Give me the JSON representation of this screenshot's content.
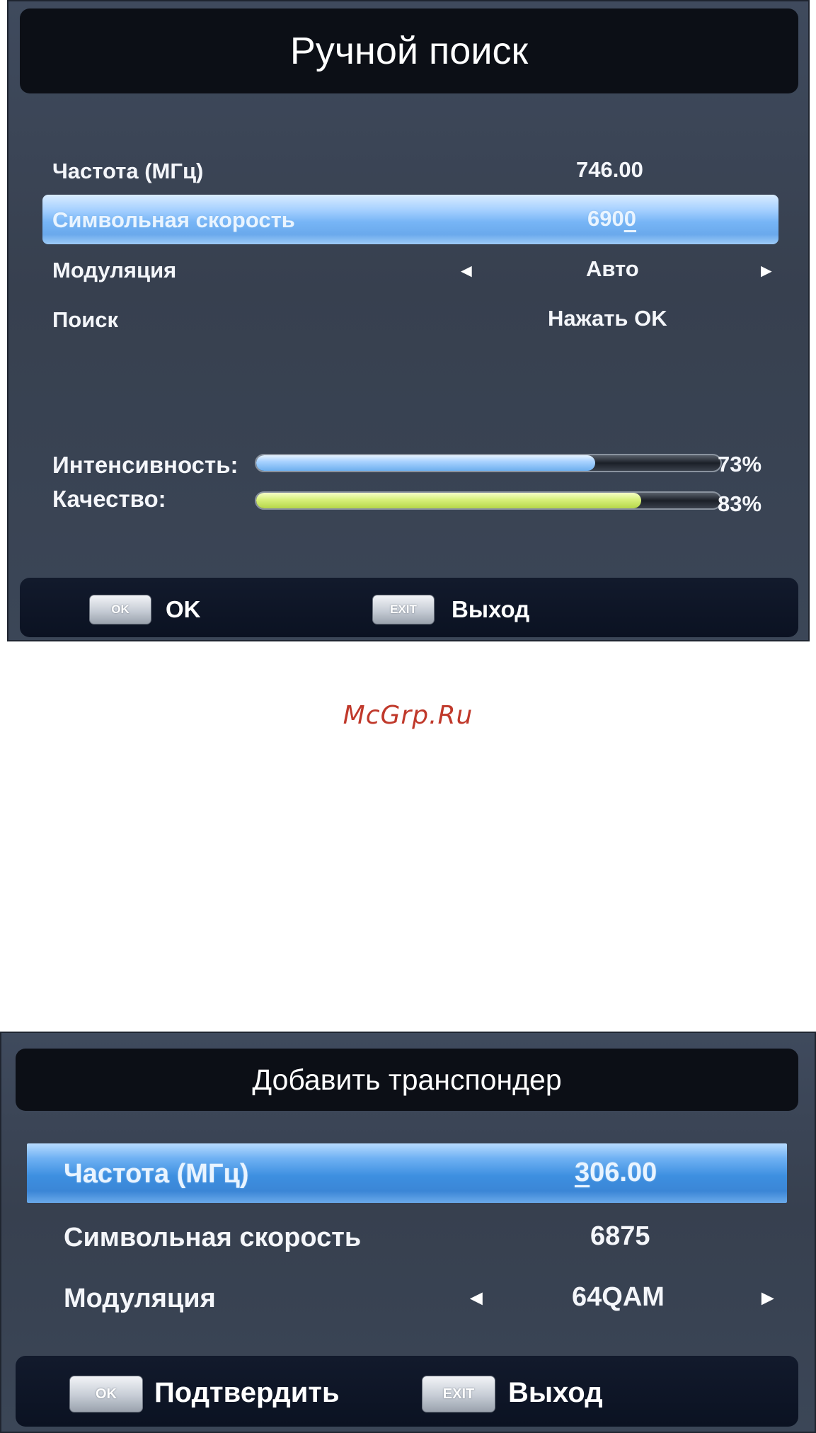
{
  "screen1": {
    "title": "Ручной поиск",
    "rows": [
      {
        "label": "Частота (МГц)",
        "value": "746.00"
      },
      {
        "label": "Символьная скорость",
        "value_prefix": "690",
        "value_cursor": "0"
      },
      {
        "label": "Модуляция",
        "value": "Авто",
        "left_arrow": "◄",
        "right_arrow": "►"
      },
      {
        "label": "Поиск",
        "value": "Нажать OK"
      }
    ],
    "signal": {
      "intensity_label": "Интенсивность:",
      "intensity_value": "73%",
      "intensity_level": 0.73,
      "quality_label": "Качество:",
      "quality_value": "83%",
      "quality_level": 0.83
    },
    "footer": {
      "ok_key": "OK",
      "ok_text": "OK",
      "exit_key": "EXIT",
      "exit_text": "Выход"
    }
  },
  "watermark": "McGrp.Ru",
  "screen2": {
    "title": "Добавить транспондер",
    "rows": [
      {
        "label": "Частота (МГц)",
        "value_cursor": "3",
        "value_rest": "06.00"
      },
      {
        "label": "Символьная скорость",
        "value": "6875"
      },
      {
        "label": "Модуляция",
        "value": "64QAM",
        "left_arrow": "◄",
        "right_arrow": "►"
      }
    ],
    "footer": {
      "ok_key": "OK",
      "ok_text": "Подтвердить",
      "exit_key": "EXIT",
      "exit_text": "Выход"
    }
  },
  "colors": {
    "highlight": "#77b5f6",
    "intensity_bar": "#a9d2ff",
    "quality_bar": "#d7f07a",
    "watermark": "#c0392b"
  }
}
